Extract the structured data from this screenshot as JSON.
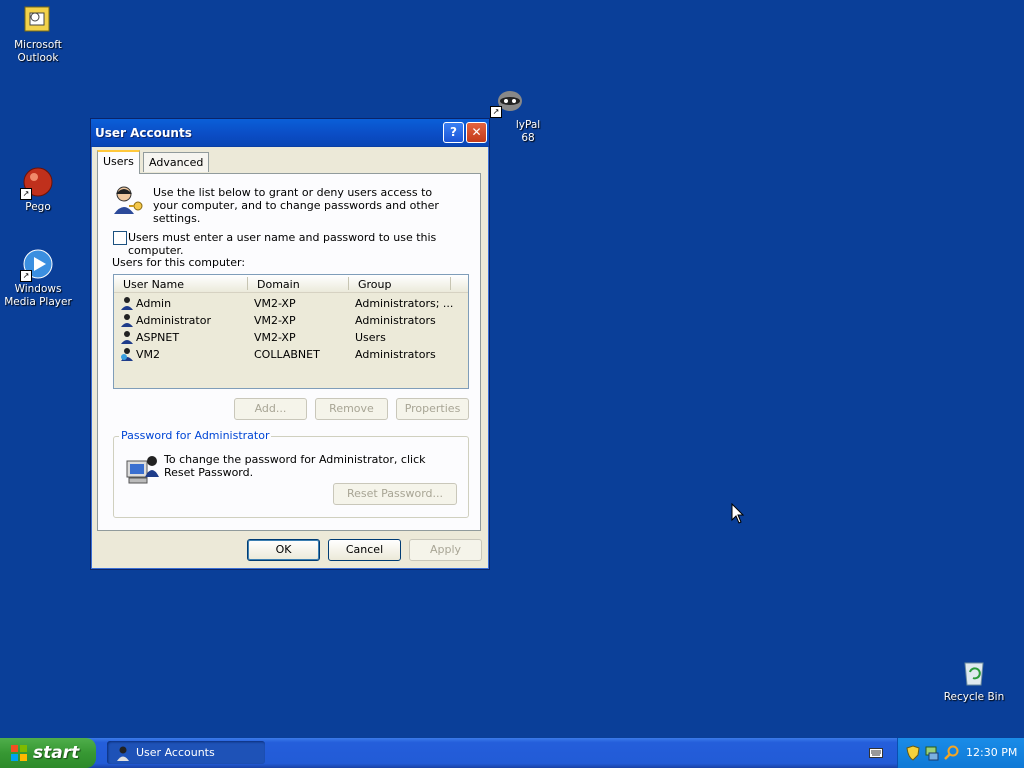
{
  "desktop": {
    "icons": [
      {
        "label": "Microsoft Outlook",
        "icon": "outlook-icon"
      },
      {
        "label": "Pego",
        "icon": "pego-icon"
      },
      {
        "label": "Windows Media Player",
        "icon": "media-player-icon"
      },
      {
        "label": "lyPal 68",
        "icon": "raccoon-icon"
      },
      {
        "label": "Recycle Bin",
        "icon": "recycle-bin-icon"
      }
    ]
  },
  "dialog": {
    "title": "User Accounts",
    "help_glyph": "?",
    "close_glyph": "✕",
    "tabs": [
      "Users",
      "Advanced"
    ],
    "intro_text": "Use the list below to grant or deny users access to your computer, and to change passwords and other settings.",
    "checkbox_label": "Users must enter a user name and password to use this computer.",
    "checkbox_checked": false,
    "list_label": "Users for this computer:",
    "columns": [
      "User Name",
      "Domain",
      "Group"
    ],
    "users": [
      {
        "name": "Admin",
        "domain": "VM2-XP",
        "group": "Administrators; ..."
      },
      {
        "name": "Administrator",
        "domain": "VM2-XP",
        "group": "Administrators"
      },
      {
        "name": "ASPNET",
        "domain": "VM2-XP",
        "group": "Users"
      },
      {
        "name": "VM2",
        "domain": "COLLABNET",
        "group": "Administrators"
      }
    ],
    "list_buttons": {
      "add": "Add...",
      "remove": "Remove",
      "properties": "Properties"
    },
    "password_group": {
      "legend": "Password for Administrator",
      "text": "To change the password for Administrator, click Reset Password.",
      "reset_button": "Reset Password..."
    },
    "footer_buttons": {
      "ok": "OK",
      "cancel": "Cancel",
      "apply": "Apply"
    }
  },
  "taskbar": {
    "start_label": "start",
    "task_item": "User Accounts",
    "clock": "12:30 PM"
  },
  "colors": {
    "desktop": "#0a3f99",
    "titlebar": "#0b4cc4",
    "start": "#379833",
    "tray": "#0f79d6"
  }
}
